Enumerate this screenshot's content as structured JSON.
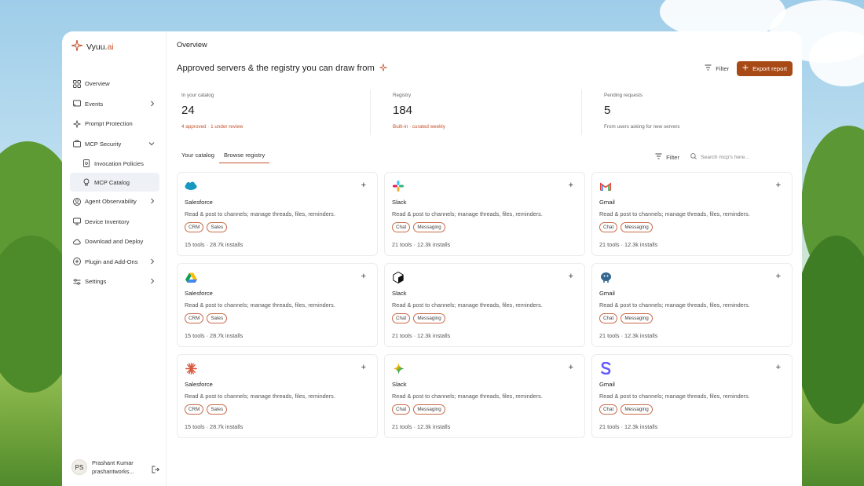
{
  "brand": {
    "name_main": "Vyuu.",
    "name_accent": "ai"
  },
  "sidebar": {
    "items": [
      {
        "label": "Overview",
        "icon": "grid-icon"
      },
      {
        "label": "Events",
        "icon": "cast-icon"
      },
      {
        "label": "Prompt Protection",
        "icon": "sparkle-icon"
      },
      {
        "label": "MCP Security",
        "icon": "briefcase-icon"
      },
      {
        "label": "Invocation Policies",
        "icon": "document-icon"
      },
      {
        "label": "MCP Catalog",
        "icon": "bulb-icon"
      },
      {
        "label": "Agent Observability",
        "icon": "person-icon"
      },
      {
        "label": "Device Inventory",
        "icon": "monitor-icon"
      },
      {
        "label": "Download and Deploy",
        "icon": "cloud-icon"
      },
      {
        "label": "Plugin and Add-Ons",
        "icon": "plus-circle-icon"
      },
      {
        "label": "Settings",
        "icon": "sliders-icon"
      }
    ],
    "user": {
      "initials": "PS",
      "name": "Prashant Kumar",
      "email": "prashantworks..."
    }
  },
  "header": {
    "page_title": "Overview",
    "headline": "Approved servers & the registry you can draw from",
    "filter_label": "Filter",
    "export_label": "Export report"
  },
  "stats": [
    {
      "label": "In your catalog",
      "value": "24",
      "sub": "4 approved · 1 under review"
    },
    {
      "label": "Registry",
      "value": "184",
      "sub": "Built-in · curated weekly"
    },
    {
      "label": "Pending requests",
      "value": "5",
      "sub": "From users asking for new servers"
    }
  ],
  "tabs": [
    {
      "label": "Your catalog"
    },
    {
      "label": "Browse registry"
    }
  ],
  "toolbar": {
    "filter_label": "Filter",
    "search_placeholder": "Search mcp's here..."
  },
  "cards": [
    {
      "logo": "salesforce-logo-icon",
      "name": "Salesforce",
      "desc": "Read & post to channels; manage threads, files, reminders.",
      "tags": [
        "CRM",
        "Sales"
      ],
      "meta": "15 tools · 28.7k installs"
    },
    {
      "logo": "slack-logo-icon",
      "name": "Slack",
      "desc": "Read & post to channels; manage threads, files, reminders.",
      "tags": [
        "Chat",
        "Messaging"
      ],
      "meta": "21 tools · 12.3k installs"
    },
    {
      "logo": "gmail-logo-icon",
      "name": "Gmail",
      "desc": "Read & post to channels; manage threads, files, reminders.",
      "tags": [
        "Chat",
        "Messaging"
      ],
      "meta": "21 tools · 12.3k installs"
    },
    {
      "logo": "google-drive-logo-icon",
      "name": "Salesforce",
      "desc": "Read & post to channels; manage threads, files, reminders.",
      "tags": [
        "CRM",
        "Sales"
      ],
      "meta": "15 tools · 28.7k installs"
    },
    {
      "logo": "cube-logo-icon",
      "name": "Slack",
      "desc": "Read & post to channels; manage threads, files, reminders.",
      "tags": [
        "Chat",
        "Messaging"
      ],
      "meta": "21 tools · 12.3k installs"
    },
    {
      "logo": "postgres-logo-icon",
      "name": "Gmail",
      "desc": "Read & post to channels; manage threads, files, reminders.",
      "tags": [
        "Chat",
        "Messaging"
      ],
      "meta": "21 tools · 12.3k installs"
    },
    {
      "logo": "starburst-logo-icon",
      "name": "Salesforce",
      "desc": "Read & post to channels; manage threads, files, reminders.",
      "tags": [
        "CRM",
        "Sales"
      ],
      "meta": "15 tools · 28.7k installs"
    },
    {
      "logo": "gemini-logo-icon",
      "name": "Slack",
      "desc": "Read & post to channels; manage threads, files, reminders.",
      "tags": [
        "Chat",
        "Messaging"
      ],
      "meta": "21 tools · 12.3k installs"
    },
    {
      "logo": "stripe-logo-icon",
      "name": "Gmail",
      "desc": "Read & post to channels; manage threads, files, reminders.",
      "tags": [
        "Chat",
        "Messaging"
      ],
      "meta": "21 tools · 12.3k installs"
    }
  ],
  "colors": {
    "accent": "#c4522b",
    "primary_button": "#a84a15",
    "active_nav": "#eef1f6"
  }
}
